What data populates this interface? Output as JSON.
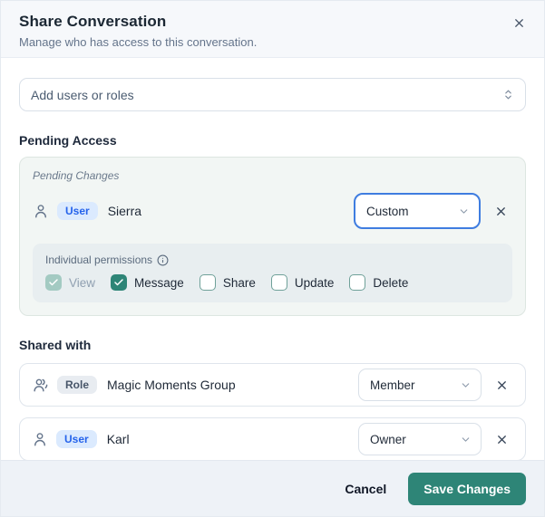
{
  "dialog": {
    "title": "Share Conversation",
    "subtitle": "Manage who has access to this conversation."
  },
  "add_select": {
    "placeholder": "Add users or roles"
  },
  "pending": {
    "section_label": "Pending Access",
    "panel_label": "Pending Changes",
    "row": {
      "type_badge": "User",
      "name": "Sierra",
      "role_value": "Custom"
    },
    "permissions": {
      "label": "Individual permissions",
      "items": [
        {
          "label": "View",
          "checked": true,
          "disabled": true
        },
        {
          "label": "Message",
          "checked": true,
          "disabled": false
        },
        {
          "label": "Share",
          "checked": false,
          "disabled": false
        },
        {
          "label": "Update",
          "checked": false,
          "disabled": false
        },
        {
          "label": "Delete",
          "checked": false,
          "disabled": false
        }
      ]
    }
  },
  "shared": {
    "section_label": "Shared with",
    "rows": [
      {
        "type_badge": "Role",
        "name": "Magic Moments Group",
        "role_value": "Member"
      },
      {
        "type_badge": "User",
        "name": "Karl",
        "role_value": "Owner"
      }
    ]
  },
  "footer": {
    "cancel_label": "Cancel",
    "save_label": "Save Changes"
  },
  "colors": {
    "accent_teal": "#2e8577",
    "focus_blue": "#3f7de0",
    "badge_user_bg": "#dbeafe",
    "badge_user_text": "#2563eb",
    "badge_role_bg": "#e8ecf1",
    "badge_role_text": "#475569"
  }
}
